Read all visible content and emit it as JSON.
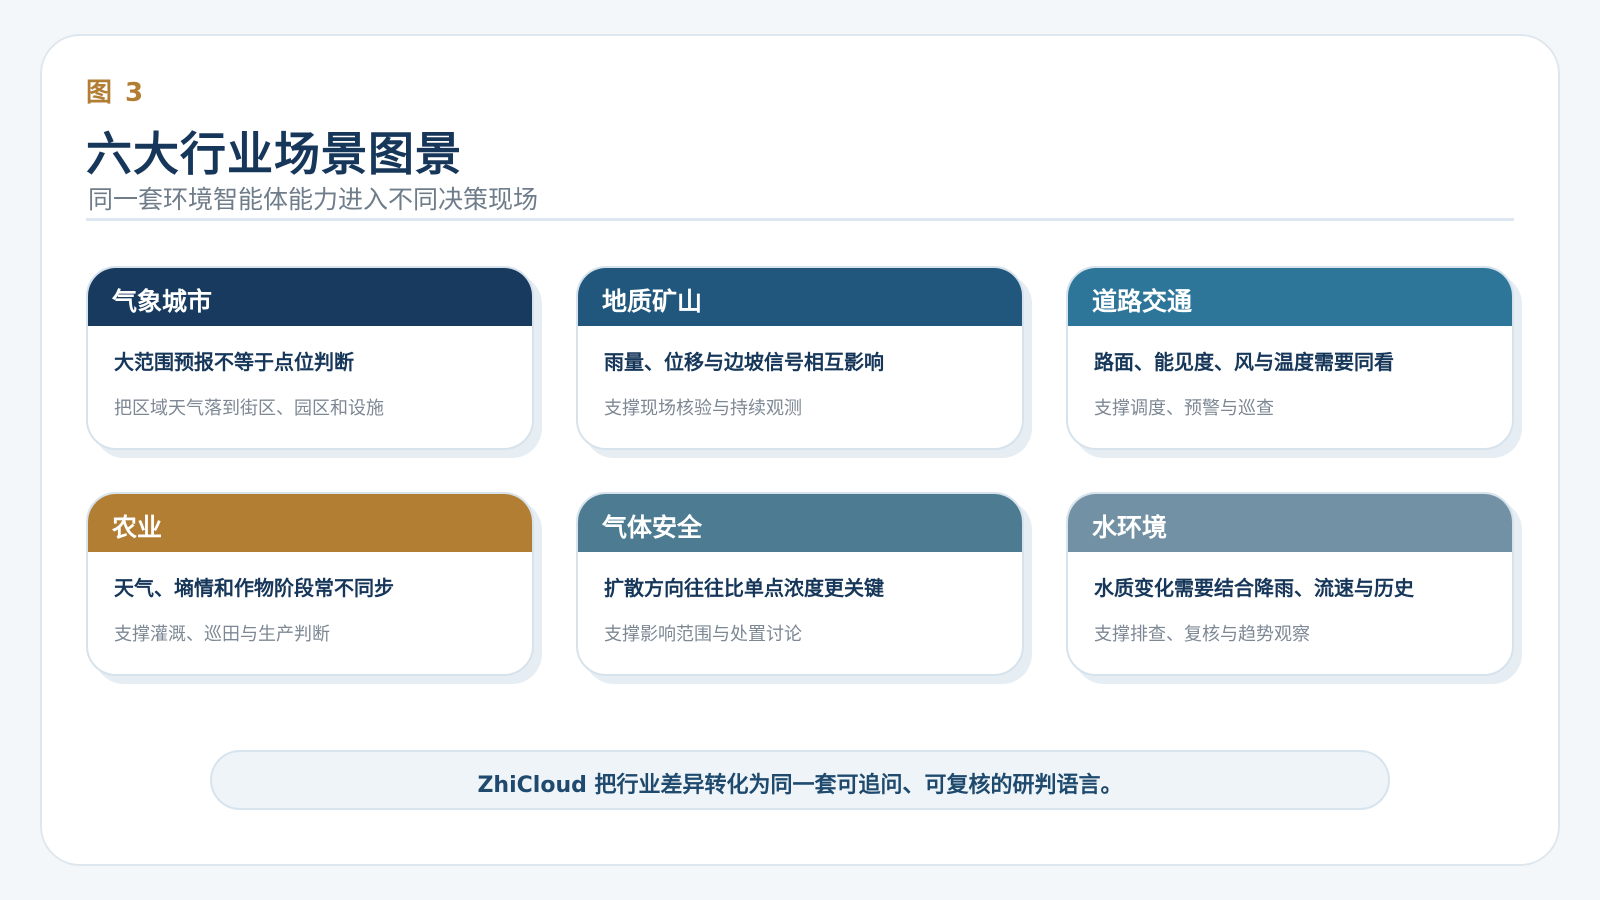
{
  "figure_label": "图 3",
  "title": "六大行业场景图景",
  "subtitle": "同一套环境智能体能力进入不同决策现场",
  "cards": [
    {
      "name": "气象城市",
      "headline": "大范围预报不等于点位判断",
      "desc": "把区域天气落到街区、园区和设施",
      "color": "#173a5e"
    },
    {
      "name": "地质矿山",
      "headline": "雨量、位移与边坡信号相互影响",
      "desc": "支撑现场核验与持续观测",
      "color": "#21577d"
    },
    {
      "name": "道路交通",
      "headline": "路面、能见度、风与温度需要同看",
      "desc": "支撑调度、预警与巡查",
      "color": "#2e7699"
    },
    {
      "name": "农业",
      "headline": "天气、墒情和作物阶段常不同步",
      "desc": "支撑灌溉、巡田与生产判断",
      "color": "#b27e33"
    },
    {
      "name": "气体安全",
      "headline": "扩散方向往往比单点浓度更关键",
      "desc": "支撑影响范围与处置讨论",
      "color": "#4d7c92"
    },
    {
      "name": "水环境",
      "headline": "水质变化需要结合降雨、流速与历史",
      "desc": "支撑排查、复核与趋势观察",
      "color": "#7391a4"
    }
  ],
  "banner": "ZhiCloud 把行业差异转化为同一套可追问、可复核的研判语言。"
}
